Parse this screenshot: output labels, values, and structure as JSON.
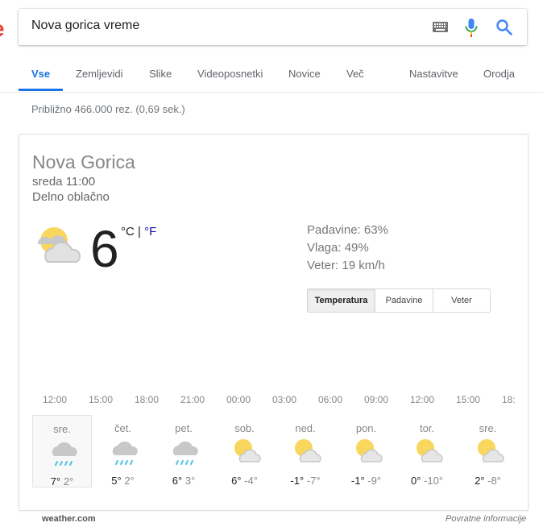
{
  "search": {
    "query": "Nova gorica vreme",
    "logo_fragment": "e"
  },
  "tabs": [
    {
      "label": "Vse",
      "active": true
    },
    {
      "label": "Zemljevidi",
      "active": false
    },
    {
      "label": "Slike",
      "active": false
    },
    {
      "label": "Videoposnetki",
      "active": false
    },
    {
      "label": "Novice",
      "active": false
    },
    {
      "label": "Več",
      "active": false
    },
    {
      "label": "Nastavitve",
      "active": false
    },
    {
      "label": "Orodja",
      "active": false
    }
  ],
  "result_stats": "Približno 466.000 rez. (0,69 sek.)",
  "weather": {
    "location": "Nova Gorica",
    "datetime": "sreda 11:00",
    "condition": "Delno oblačno",
    "icon": "partly-cloudy",
    "temperature": "6",
    "unit_c": "°C",
    "unit_sep": " | ",
    "unit_f": "°F",
    "precipitation": "Padavine: 63%",
    "humidity": "Vlaga: 49%",
    "wind": "Veter: 19 km/h",
    "chart_tabs": [
      {
        "label": "Temperatura",
        "active": true
      },
      {
        "label": "Padavine",
        "active": false
      },
      {
        "label": "Veter",
        "active": false
      }
    ],
    "hours": [
      "12:00",
      "15:00",
      "18:00",
      "21:00",
      "00:00",
      "03:00",
      "06:00",
      "09:00",
      "12:00",
      "15:00",
      "18:"
    ],
    "days": [
      {
        "name": "sre.",
        "icon": "rain",
        "hi": "7°",
        "lo": "2°",
        "selected": true
      },
      {
        "name": "čet.",
        "icon": "rain",
        "hi": "5°",
        "lo": "2°",
        "selected": false
      },
      {
        "name": "pet.",
        "icon": "rain",
        "hi": "6°",
        "lo": "3°",
        "selected": false
      },
      {
        "name": "sob.",
        "icon": "partly-cloudy",
        "hi": "6°",
        "lo": "-4°",
        "selected": false
      },
      {
        "name": "ned.",
        "icon": "partly-cloudy",
        "hi": "-1°",
        "lo": "-7°",
        "selected": false
      },
      {
        "name": "pon.",
        "icon": "partly-cloudy",
        "hi": "-1°",
        "lo": "-9°",
        "selected": false
      },
      {
        "name": "tor.",
        "icon": "partly-cloudy",
        "hi": "0°",
        "lo": "-10°",
        "selected": false
      },
      {
        "name": "sre.",
        "icon": "partly-cloudy",
        "hi": "2°",
        "lo": "-8°",
        "selected": false
      }
    ],
    "source": "weather.com",
    "feedback": "Povratne informacije"
  },
  "colors": {
    "accent": "#1a73e8",
    "sun": "#f9d65c",
    "cloud": "#c8c8c8",
    "rain": "#4fc3e8"
  }
}
